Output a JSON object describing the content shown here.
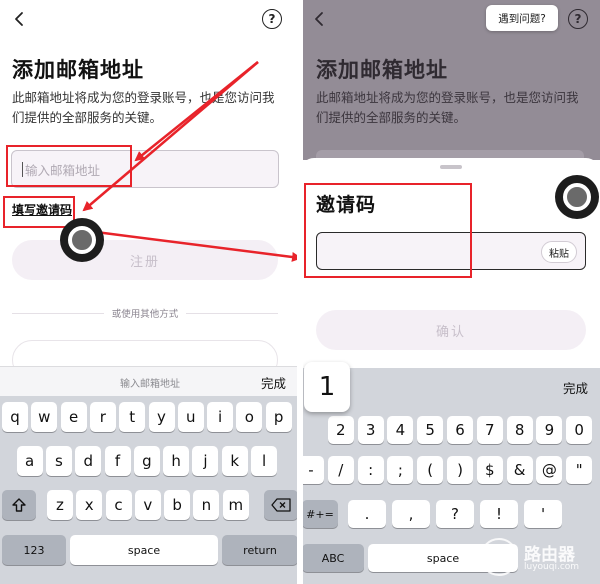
{
  "left_screen": {
    "title": "添加邮箱地址",
    "description": "此邮箱地址将成为您的登录账号，也是您访问我们提供的全部服务的关键。",
    "email_placeholder": "输入邮箱地址",
    "invite_link": "填写邀请码",
    "register_button": "注册",
    "alt_methods": "或使用其他方式",
    "toolbar_hint": "输入邮箱地址",
    "toolbar_done": "完成",
    "keyboard": {
      "row1": [
        "q",
        "w",
        "e",
        "r",
        "t",
        "y",
        "u",
        "i",
        "o",
        "p"
      ],
      "row2": [
        "a",
        "s",
        "d",
        "f",
        "g",
        "h",
        "j",
        "k",
        "l"
      ],
      "row3": [
        "z",
        "x",
        "c",
        "v",
        "b",
        "n",
        "m"
      ],
      "numbers_key": "123",
      "space_key": "space",
      "return_key": "return"
    }
  },
  "right_screen": {
    "title": "添加邮箱地址",
    "description": "此邮箱地址将成为您的登录账号，也是您访问我们提供的全部服务的关键。",
    "trouble_chip": "遇到问题?",
    "sheet_title": "邀请码",
    "paste_button": "粘贴",
    "confirm_button": "确认",
    "toolbar_done": "完成",
    "popup_key": "1",
    "keyboard": {
      "row1": [
        "1",
        "2",
        "3",
        "4",
        "5",
        "6",
        "7",
        "8",
        "9",
        "0"
      ],
      "row2": [
        "-",
        "/",
        ":",
        ";",
        "(",
        ")",
        "$",
        "&",
        "@",
        "\""
      ],
      "row3": [
        ".",
        ",",
        "?",
        "!",
        "'"
      ],
      "symbols_key": "#+=",
      "abc_key": "ABC",
      "space_key": "space"
    }
  },
  "icons": {
    "back": "chevron-left-icon",
    "help": "question-circle-icon",
    "shift": "shift-icon",
    "backspace": "backspace-icon"
  },
  "help_glyph": "?",
  "watermark": {
    "text": "路由器",
    "url": "luyouqi.com"
  },
  "colors": {
    "annotation_red": "#e8232a",
    "input_fill": "#f7f3f8",
    "disabled_button": "#f4eff5",
    "keyboard_bg": "#d2d5db",
    "dim_overlay": "#938c96"
  }
}
